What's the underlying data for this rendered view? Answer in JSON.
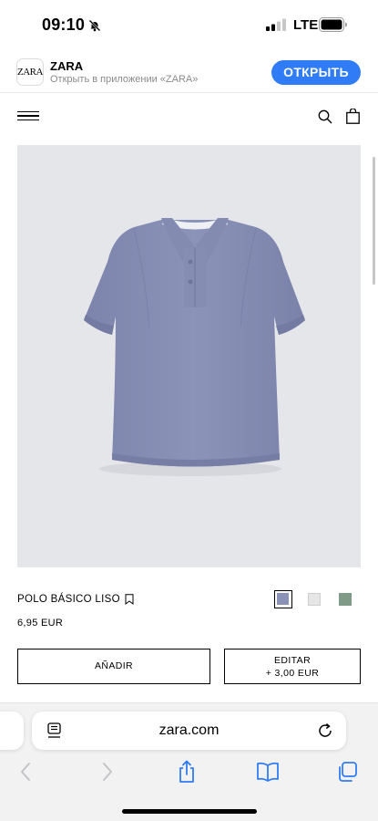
{
  "status_bar": {
    "time": "09:10",
    "network": "LTE",
    "icons": [
      "bell-slash-icon",
      "signal-icon",
      "battery-icon"
    ]
  },
  "app_banner": {
    "logo_text": "ZARA",
    "app_name": "ZARA",
    "subtitle": "Открыть в приложении «ZARA»",
    "open_label": "ОТКРЫТЬ",
    "open_color": "#2f7cf6"
  },
  "header": {
    "icons": [
      "menu-icon",
      "search-icon",
      "shopping-bag-icon"
    ]
  },
  "product": {
    "name": "POLO BÁSICO LISO",
    "price": "6,95 EUR",
    "image_background": "#e5e6ea",
    "shirt_color": "#8a92b8",
    "colors": [
      {
        "hex": "#8a92b8",
        "selected": true
      },
      {
        "hex": "#e6e6e6",
        "selected": false
      },
      {
        "hex": "#7f9a86",
        "selected": false
      }
    ]
  },
  "actions": {
    "add_label": "AÑADIR",
    "edit_label": "EDITAR",
    "edit_price": "+ 3,00 EUR"
  },
  "browser": {
    "url": "zara.com",
    "toolbar_icons": [
      "back-icon",
      "forward-icon",
      "share-icon",
      "bookmarks-icon",
      "tabs-icon"
    ]
  }
}
